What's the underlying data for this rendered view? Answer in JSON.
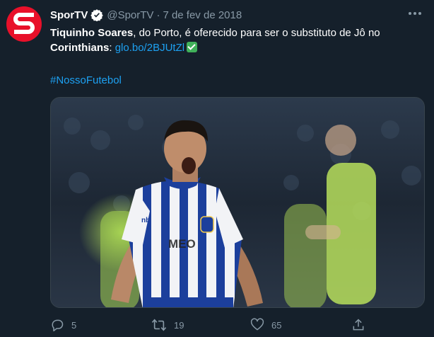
{
  "author": {
    "display_name": "SporTV",
    "handle": "@SporTV",
    "separator": "·",
    "date": "7 de fev de 2018",
    "avatar_icon": "sportv-logo",
    "avatar_color": "#e8102a"
  },
  "tweet": {
    "text_bold_1": "Tiquinho Soares",
    "text_1": ", do Porto, é oferecido para ser o substituto de Jô no",
    "text_bold_2": "Corinthians",
    "text_2": ": ",
    "link": "glo.bo/2BJUtZl",
    "hashtag": "#NossoFutebol"
  },
  "image": {
    "jersey_text": "MEO",
    "sleeve_brand": "nb"
  },
  "actions": {
    "reply_count": "5",
    "retweet_count": "19",
    "like_count": "65"
  },
  "colors": {
    "background": "#15202b",
    "text_secondary": "#8899a6",
    "link": "#1da1f2",
    "verified": "#ffffff"
  }
}
